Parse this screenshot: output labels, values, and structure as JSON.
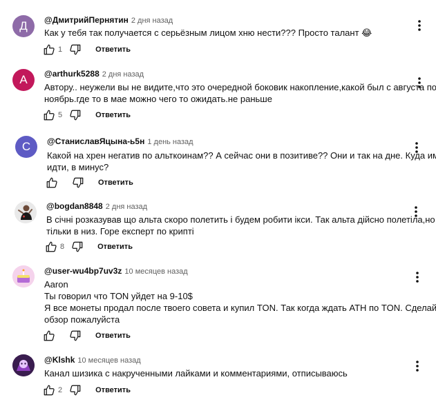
{
  "reply_label": "Ответить",
  "comments": [
    {
      "avatar_letter": "Д",
      "avatar_color": "#8e6ba8",
      "author": "@ДмитрийПернятин",
      "time": "2 дня назад",
      "lines": [
        "Как у тебя так получается с серьёзным лицом хню нести??? Просто талант 😂"
      ],
      "likes": "1"
    },
    {
      "avatar_letter": "A",
      "avatar_color": "#c2185b",
      "author": "@arthurk5288",
      "time": "2 дня назад",
      "lines": [
        "Автору.. неужели вы не видите,что это очередной боковик накопление,какой был с августа по",
        "ноябрь.где то в мае можно чего то ожидать.не раньше"
      ],
      "likes": "5"
    },
    {
      "avatar_letter": "C",
      "avatar_color": "#5e5bc4",
      "author": "@СтаниславЯцына-ь5н",
      "time": "1 день назад",
      "lines": [
        "Какой на хрен негатив по альткоинам?? А сейчас они в позитиве?? Они и так на дне. Куда им",
        "идти, в минус?"
      ],
      "likes": ""
    },
    {
      "avatar_letter": "",
      "avatar_color": "#e8e8e8",
      "author": "@bogdan8848",
      "time": "2 дня назад",
      "lines": [
        "В січні розказував що альта скоро полетить і будем робити ікси. Так альта дійсно полетіла,но",
        "тільки в низ. Горе експерт по крипті"
      ],
      "likes": "8"
    },
    {
      "avatar_letter": "",
      "avatar_color": "#f3c7e8",
      "author": "@user-wu4bp7uv3z",
      "time": "10 месяцев назад",
      "lines": [
        "Aaron",
        "Ты говорил что TON уйдет на 9-10$",
        "Я все монеты продал после твоего совета и купил TON. Так когда ждать ATH по TON. Сделай",
        "обзор пожалуйста"
      ],
      "likes": ""
    },
    {
      "avatar_letter": "",
      "avatar_color": "#3a1d4f",
      "author": "@Klshk",
      "time": "10 месяцев назад",
      "lines": [
        "Канал шизика с накрученными лайками и комментариями, отписываюсь"
      ],
      "likes": "2"
    }
  ]
}
